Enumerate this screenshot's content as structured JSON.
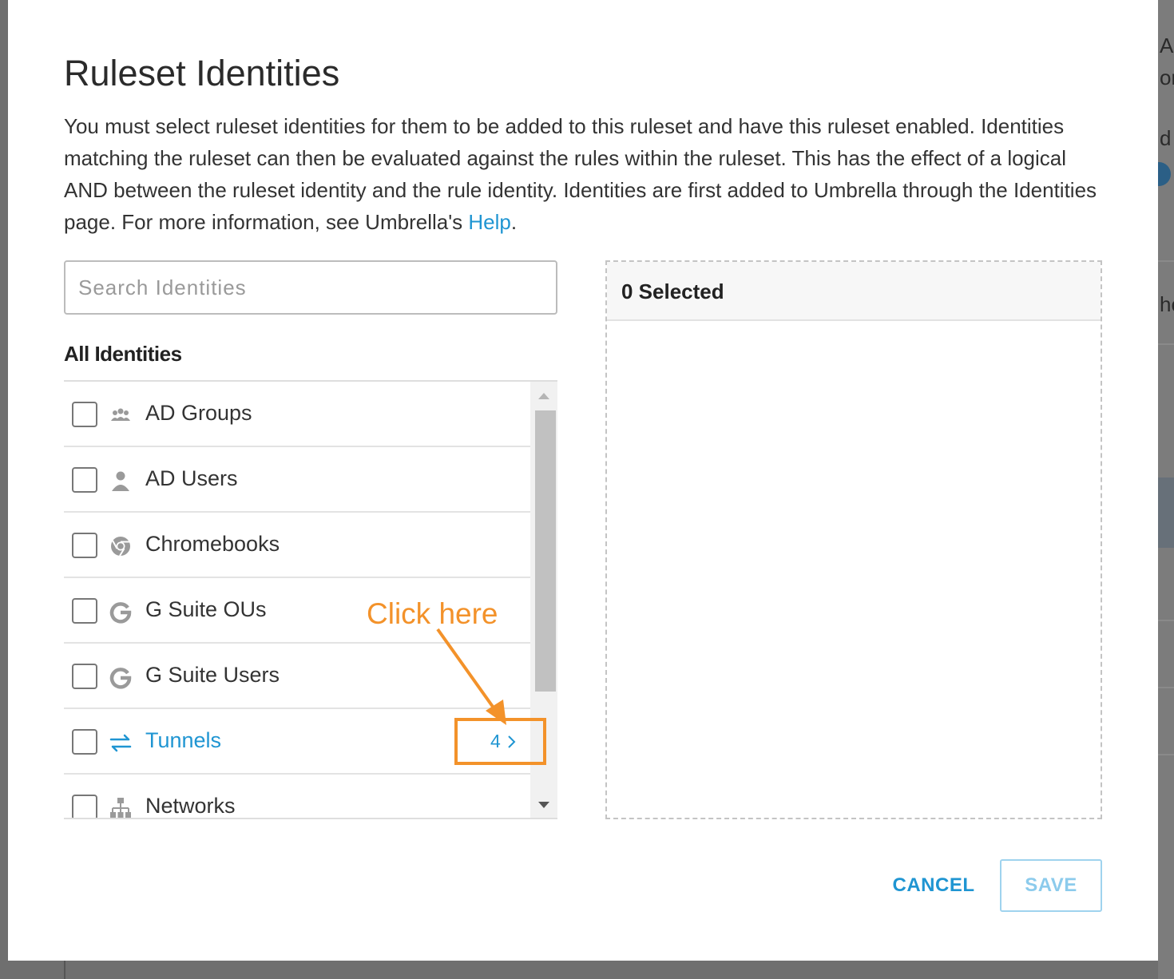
{
  "background_fragments": [
    "A",
    "or",
    "d F",
    "ho"
  ],
  "modal": {
    "title": "Ruleset Identities",
    "description": {
      "text": "You must select ruleset identities for them to be added to this ruleset and have this ruleset enabled. Identities matching the ruleset can then be evaluated against the rules within the ruleset. This has the effect of a logical AND between the ruleset identity and the rule identity. Identities are first added to Umbrella through the Identities page. For more information, see Umbrella's ",
      "link_text": "Help",
      "suffix": "."
    },
    "search": {
      "placeholder": "Search Identities",
      "value": ""
    },
    "list_label": "All Identities",
    "identities": [
      {
        "label": "AD Groups",
        "icon": "ad-groups-icon",
        "checked": false
      },
      {
        "label": "AD Users",
        "icon": "ad-users-icon",
        "checked": false
      },
      {
        "label": "Chromebooks",
        "icon": "chrome-icon",
        "checked": false
      },
      {
        "label": "G Suite OUs",
        "icon": "google-g-icon",
        "checked": false
      },
      {
        "label": "G Suite Users",
        "icon": "google-g-icon",
        "checked": false
      },
      {
        "label": "Tunnels",
        "icon": "tunnel-arrows-icon",
        "checked": false,
        "count": "4",
        "is_link": true
      },
      {
        "label": "Networks",
        "icon": "network-icon",
        "checked": false
      }
    ],
    "selected_panel": {
      "header": "0 Selected"
    },
    "buttons": {
      "cancel": "CANCEL",
      "save": "SAVE"
    }
  },
  "annotation": {
    "text": "Click here",
    "color": "#f3922a"
  },
  "colors": {
    "link": "#1f95d2",
    "annotation": "#f3922a",
    "save_disabled": "#8ccbec"
  }
}
